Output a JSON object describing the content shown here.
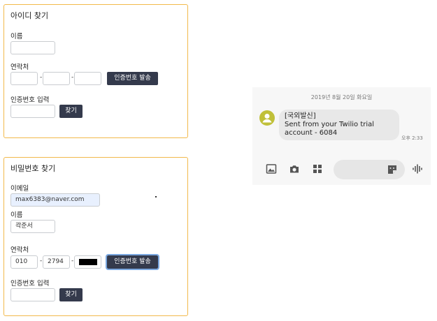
{
  "find_id": {
    "title": "아이디 찾기",
    "name_label": "이름",
    "phone_label": "연락처",
    "phone_dash": "-",
    "send_button": "인증번호 발송",
    "code_label": "인증번호 입력",
    "find_button": "찾기"
  },
  "find_pw": {
    "title": "비밀번호 찾기",
    "email_label": "이메일",
    "email_value": "max6383@naver.com",
    "name_label": "이름",
    "name_value": "곽준서",
    "phone_label": "연락처",
    "phone_part1": "010",
    "phone_part2": "2794",
    "phone_dash": "-",
    "send_button": "인증번호 발송",
    "code_label": "인증번호 입력",
    "find_button": "찾기"
  },
  "sms": {
    "date": "2019년 8월 20일 화요일",
    "message_lines": [
      "[국외발신]",
      "Sent from your Twilio trial",
      "account - 6084"
    ],
    "time": "오후 2:33",
    "toolbar_icons": [
      "gallery-icon",
      "camera-icon",
      "apps-icon",
      "sticker-icon",
      "voice-icon"
    ]
  },
  "colors": {
    "panel_border": "#f2b94b",
    "button_bg": "#343a4c",
    "avatar": "#c0c03a"
  }
}
